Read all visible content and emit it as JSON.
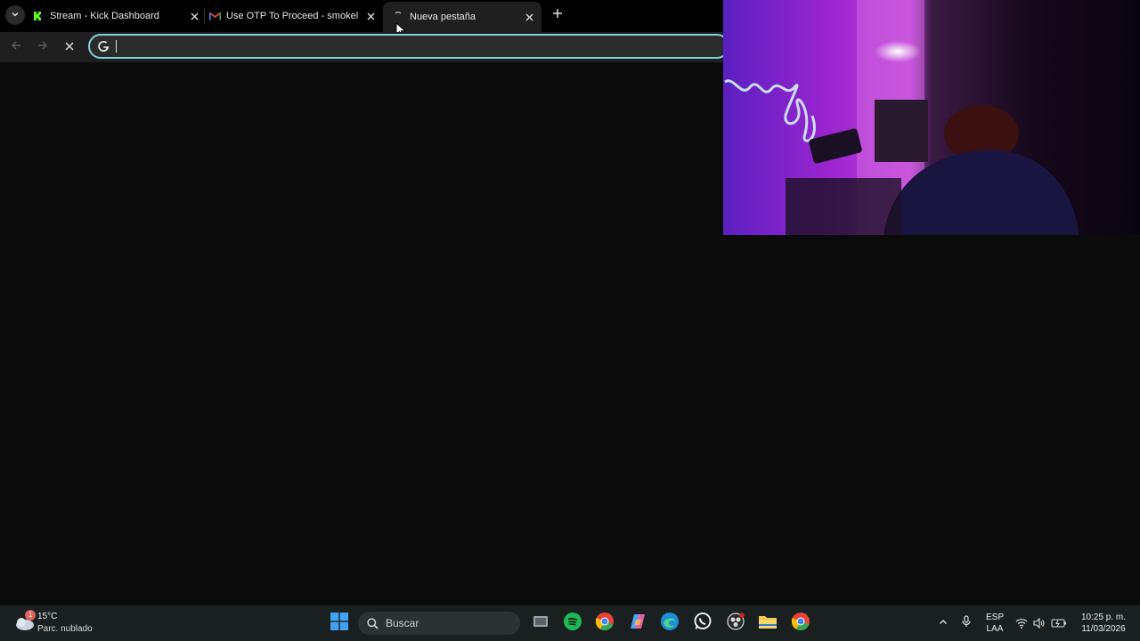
{
  "tabs": [
    {
      "title": "Stream - Kick Dashboard",
      "icon": "kick-icon",
      "active": false
    },
    {
      "title": "Use OTP To Proceed - smokelh",
      "icon": "gmail-icon",
      "active": false
    },
    {
      "title": "Nueva pestaña",
      "icon": "loading-icon",
      "active": true
    }
  ],
  "omnibox": {
    "value": "",
    "placeholder": ""
  },
  "taskbar": {
    "weather": {
      "temp": "15°C",
      "desc": "Parc. nublado",
      "badge": "1"
    },
    "search_label": "Buscar",
    "lang_top": "ESP",
    "lang_bottom": "LAA",
    "time": "10:25 p. m.",
    "date": "11/03/2026"
  },
  "colors": {
    "accent": "#7fcfd9",
    "kick": "#53fc18",
    "spotify": "#1db954"
  }
}
